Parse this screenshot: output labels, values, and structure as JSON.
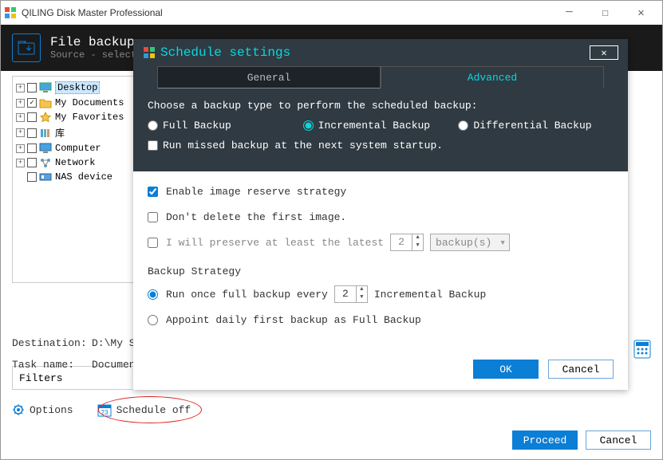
{
  "app": {
    "title": "QILING Disk Master Professional"
  },
  "header": {
    "title": "File backup",
    "subtitle": "Source - select"
  },
  "tree": {
    "items": [
      {
        "label": "Desktop",
        "checked": false,
        "expand": "+",
        "selected": true
      },
      {
        "label": "My Documents",
        "checked": true,
        "expand": "+"
      },
      {
        "label": "My Favorites",
        "checked": false,
        "expand": "+"
      },
      {
        "label": "库",
        "checked": false,
        "expand": "+"
      },
      {
        "label": "Computer",
        "checked": false,
        "expand": "+"
      },
      {
        "label": "Network",
        "checked": false,
        "expand": "+"
      },
      {
        "label": "NAS device",
        "checked": false,
        "expand": ""
      }
    ]
  },
  "filters_label": "Filters",
  "fields": {
    "destination_label": "Destination:",
    "destination_value": "D:\\My Sto",
    "taskname_label": "Task name:",
    "taskname_value": "Documents"
  },
  "bottom": {
    "options_label": "Options",
    "schedule_label": "Schedule off"
  },
  "main_buttons": {
    "proceed": "Proceed",
    "cancel": "Cancel"
  },
  "modal": {
    "title": "Schedule settings",
    "tabs": {
      "general": "General",
      "advanced": "Advanced"
    },
    "instruction": "Choose a backup type to perform the scheduled backup:",
    "radios": {
      "full": "Full Backup",
      "incremental": "Incremental Backup",
      "differential": "Differential Backup"
    },
    "run_missed": "Run missed backup at the next system startup.",
    "enable_reserve": "Enable image reserve strategy",
    "dont_delete": "Don't delete the first image.",
    "preserve_prefix": "I will preserve at least the latest",
    "preserve_value": "2",
    "preserve_unit": "backup(s)",
    "strategy_title": "Backup Strategy",
    "strategy_run_prefix": "Run once full backup every",
    "strategy_run_value": "2",
    "strategy_run_suffix": "Incremental Backup",
    "strategy_appoint": "Appoint daily first backup as Full Backup",
    "buttons": {
      "ok": "OK",
      "cancel": "Cancel"
    }
  }
}
